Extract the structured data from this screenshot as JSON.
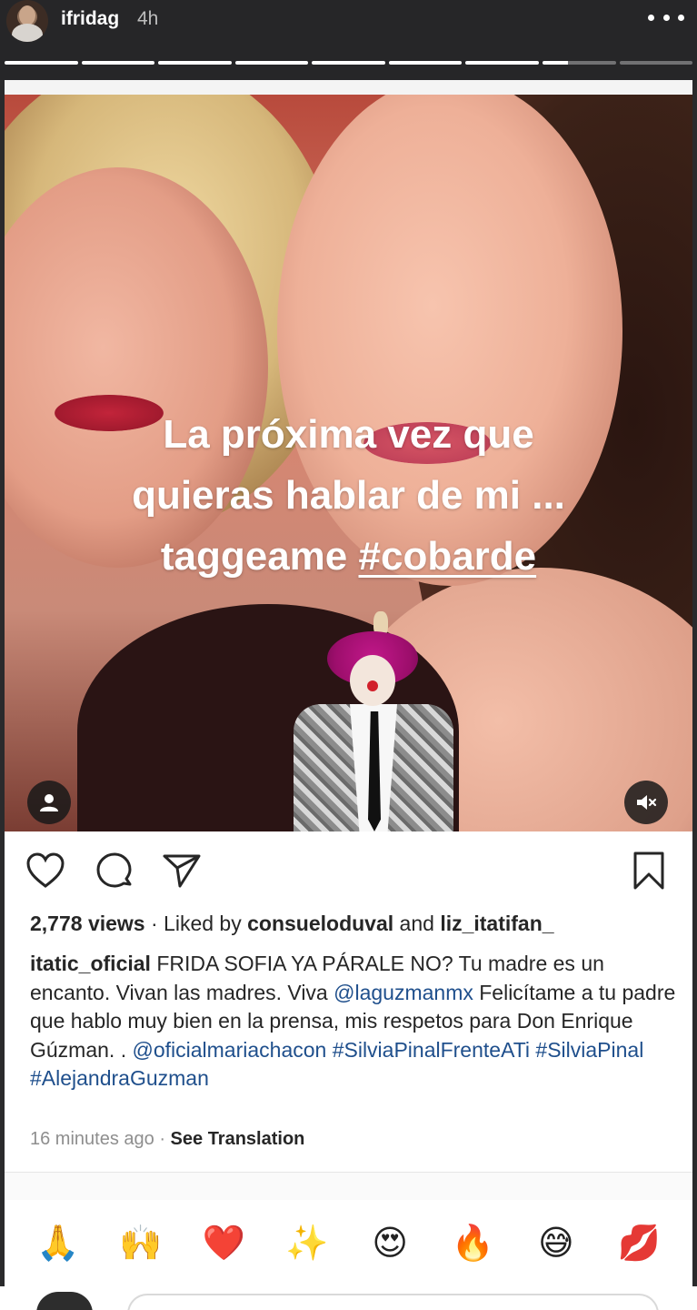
{
  "story": {
    "username": "ifridag",
    "time_ago": "4h",
    "more_icon": "more-horizontal-icon",
    "progress": {
      "segments": 9,
      "completed": 7,
      "current_fraction": 0.35
    }
  },
  "post": {
    "overlay_text": {
      "line1": "La próxima vez que",
      "line2": "quieras hablar de mi ...",
      "line3_prefix": "taggeame ",
      "line3_hashtag": "#cobarde"
    },
    "icons": {
      "user_tag": "user-icon",
      "mute": "volume-mute-icon",
      "like": "heart-outline-icon",
      "comment": "comment-icon",
      "share": "send-icon",
      "save": "bookmark-icon"
    },
    "views": "2,778 views",
    "liked_by_prefix": " · Liked by ",
    "liked_by_user": "consueloduval",
    "liked_by_and": " and ",
    "liked_by_other": "liz_itatifan_",
    "caption": {
      "author": "itatic_oficial",
      "text_part1": " FRIDA SOFIA YA PÁRALE NO? Tu madre es un encanto. Vivan las madres. Viva ",
      "mention1": "@laguzmanmx",
      "text_part2": " Felicítame a tu padre que hablo muy bien en la prensa, mis respetos para Don Enrique Gúzman. . ",
      "mention2": "@oficialmariachacon",
      "hashtags": "#SilviaPinalFrenteATi #SilviaPinal #AlejandraGuzman"
    },
    "time_ago": "16 minutes ago",
    "separator": " · ",
    "see_translation": "See Translation"
  },
  "reactions": [
    "🙏",
    "🙌",
    "❤️",
    "✨",
    "😍",
    "🔥",
    "😅",
    "💋"
  ],
  "colors": {
    "header_bg": "#262628",
    "mention_blue": "#1f4f8c",
    "text_dark": "#262626",
    "text_muted": "#8e8e8e"
  }
}
